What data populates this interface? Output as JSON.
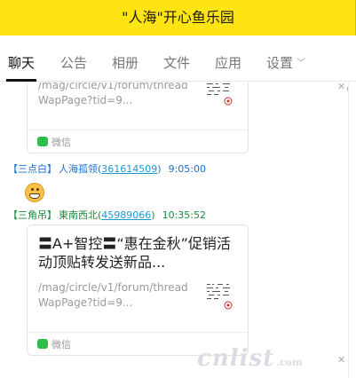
{
  "window": {
    "title": "\"人海\"开心鱼乐园"
  },
  "tabs": [
    {
      "label": "聊天",
      "active": true
    },
    {
      "label": "公告"
    },
    {
      "label": "相册"
    },
    {
      "label": "文件"
    },
    {
      "label": "应用"
    },
    {
      "label": "设置",
      "has_dropdown": true
    }
  ],
  "icons": {
    "phone": "phone-icon",
    "close": "close-icon",
    "wechat": "wechat-icon",
    "emoji": "grin-emoji-icon"
  },
  "colors": {
    "titlebar": "#ffe413",
    "sender_blue": "#1a6fd6",
    "sender_green": "#1b8a3a",
    "wechat_green": "#2cbd4a"
  },
  "messages": [
    {
      "type": "link_card",
      "url_text": "/mag/circle/v1/forum/threadWapPage?tid=9...",
      "source": "微信"
    },
    {
      "sender": {
        "tag": "【三点白】",
        "nickname": "人海孤领",
        "qq": "361614509",
        "time": "9:05:00"
      },
      "type": "emoji"
    },
    {
      "sender": {
        "tag": "【三角吊】",
        "nickname": "東南西北",
        "qq": "45989066",
        "time": "10:35:52"
      },
      "type": "link_card",
      "title": "〓A+智控〓“惠在金秋”促销活动顶贴转发送新品...",
      "url_text": "/mag/circle/v1/forum/threadWapPage?tid=9...",
      "source": "微信"
    }
  ],
  "watermark": {
    "text": "cnlist",
    "suffix": ".com"
  }
}
